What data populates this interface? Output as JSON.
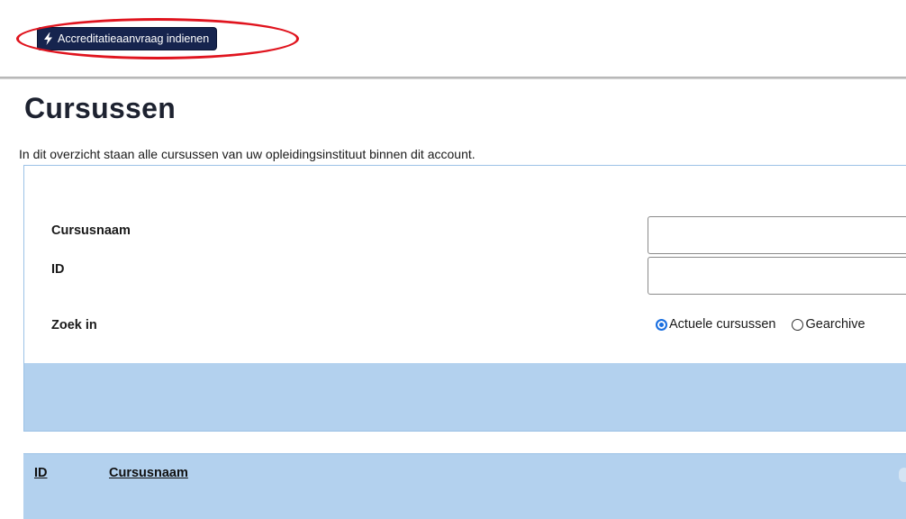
{
  "toolbar": {
    "action_button_label": "Accreditatieaanvraag indienen",
    "action_icon": "bolt-icon"
  },
  "annotation": {
    "color": "#e0141e"
  },
  "page": {
    "title": "Cursussen",
    "intro": "In dit overzicht staan alle cursussen van uw opleidingsinstituut binnen dit account."
  },
  "search": {
    "course_name_label": "Cursusnaam",
    "course_name_value": "",
    "id_label": "ID",
    "id_value": "",
    "search_in_label": "Zoek in",
    "options": [
      {
        "label": "Actuele cursussen",
        "checked": true
      },
      {
        "label": "Gearchive",
        "checked": false
      }
    ]
  },
  "results": {
    "columns": [
      "ID",
      "Cursusnaam"
    ]
  },
  "colors": {
    "button_bg": "#16244e",
    "panel_blue": "#b3d1ee",
    "panel_border": "#9cc2e6",
    "radio_accent": "#1a6fe0"
  }
}
